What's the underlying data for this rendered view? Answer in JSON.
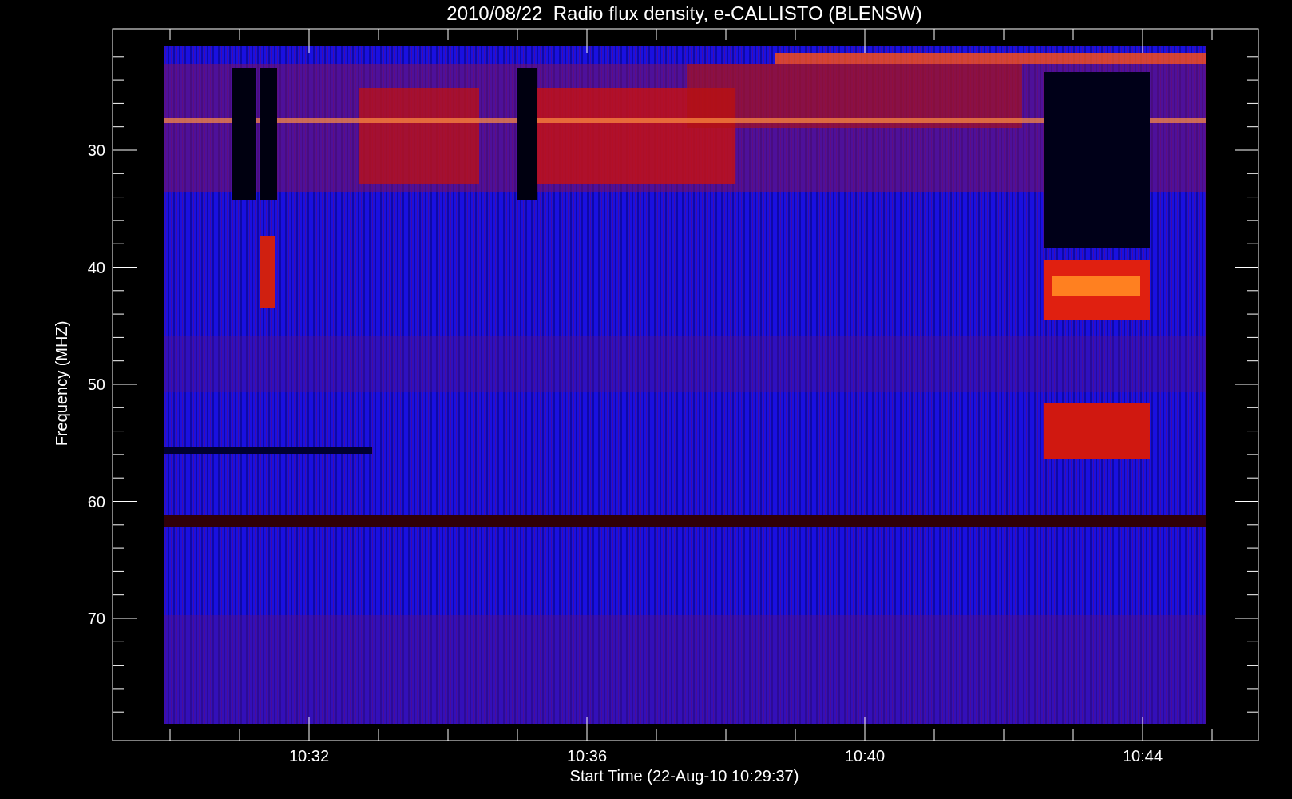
{
  "title": "2010/08/22  Radio flux density, e-CALLISTO (BLENSW)",
  "y_axis": {
    "label": "Frequency (MHZ)",
    "ticks": [
      "30",
      "40",
      "50",
      "60",
      "70"
    ]
  },
  "x_axis": {
    "label": "Start Time (22-Aug-10 10:29:37)",
    "ticks": [
      "10:32",
      "10:36",
      "10:40",
      "10:44"
    ]
  }
}
